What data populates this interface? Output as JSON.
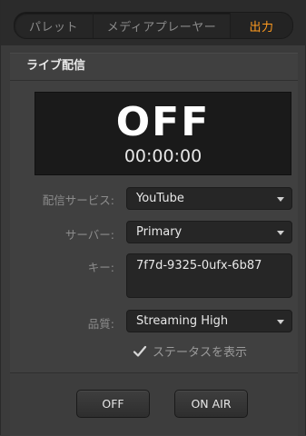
{
  "tabs": [
    {
      "label": "パレット"
    },
    {
      "label": "メディアプレーヤー"
    },
    {
      "label": "出力"
    }
  ],
  "section": {
    "title": "ライブ配信"
  },
  "display": {
    "status": "OFF",
    "timer": "00:00:00"
  },
  "fields": {
    "service_label": "配信サービス:",
    "service_value": "YouTube",
    "server_label": "サーバー:",
    "server_value": "Primary",
    "key_label": "キー:",
    "key_value": "7f7d-9325-0ufx-6b87",
    "quality_label": "品質:",
    "quality_value": "Streaming High"
  },
  "show_status": {
    "label": "ステータスを表示",
    "checked": true
  },
  "buttons": {
    "off": "OFF",
    "on_air": "ON AIR"
  },
  "colors": {
    "active_tab": "#ff9b1f"
  }
}
